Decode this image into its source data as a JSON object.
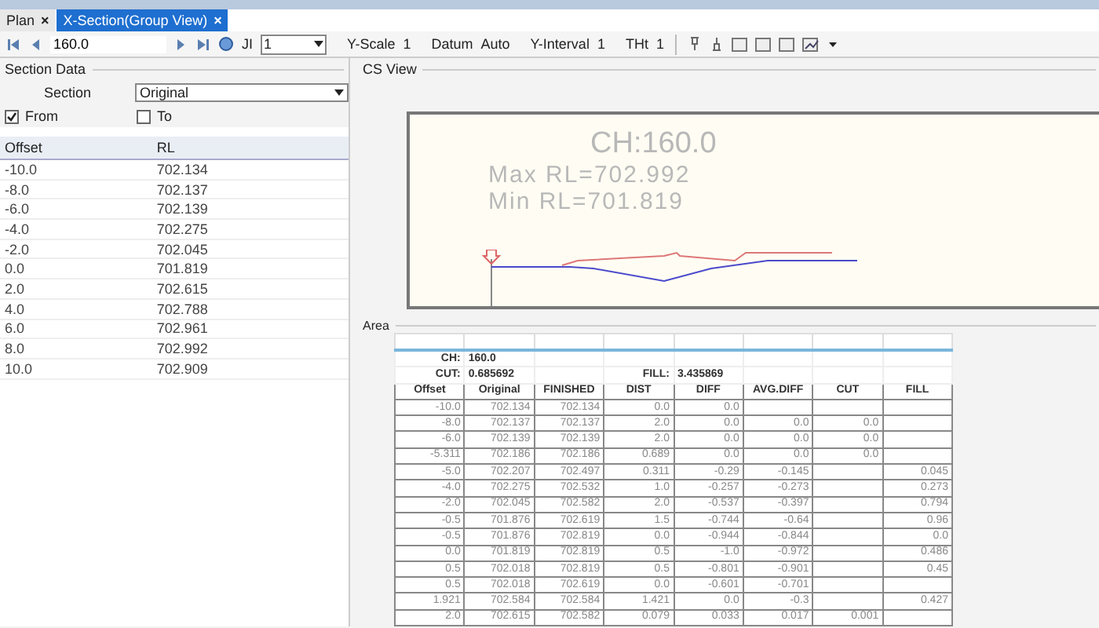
{
  "tabs": [
    {
      "label": "Plan",
      "selected": false,
      "close": "×"
    },
    {
      "label": "X-Section(Group View)",
      "selected": true,
      "close": "×"
    }
  ],
  "toolbar": {
    "chainage": "160.0",
    "ji_label": "JI",
    "ji_value": "1",
    "settings": [
      {
        "label": "Y-Scale",
        "value": "1"
      },
      {
        "label": "Datum",
        "value": "Auto"
      },
      {
        "label": "Y-Interval",
        "value": "1"
      },
      {
        "label": "THt",
        "value": "1"
      }
    ]
  },
  "section_data": {
    "title": "Section Data",
    "section_label": "Section",
    "section_value": "Original",
    "options": [
      {
        "label": "From",
        "checked": true
      },
      {
        "label": "To",
        "checked": false
      }
    ],
    "columns": [
      "Offset",
      "RL"
    ],
    "rows": [
      [
        "-10.0",
        "702.134"
      ],
      [
        "-8.0",
        "702.137"
      ],
      [
        "-6.0",
        "702.139"
      ],
      [
        "-4.0",
        "702.275"
      ],
      [
        "-2.0",
        "702.045"
      ],
      [
        "0.0",
        "701.819"
      ],
      [
        "2.0",
        "702.615"
      ],
      [
        "4.0",
        "702.788"
      ],
      [
        "6.0",
        "702.961"
      ],
      [
        "8.0",
        "702.992"
      ],
      [
        "10.0",
        "702.909"
      ]
    ]
  },
  "cs_view": {
    "title": "CS View",
    "chainage": "CH:160.0",
    "max": "Max  RL=702.992",
    "min": "Min  RL=701.819"
  },
  "area": {
    "title": "Area",
    "ch_label": "CH:",
    "ch_value": "160.0",
    "cut_label": "CUT:",
    "cut_value": "0.685692",
    "fill_label": "FILL:",
    "fill_value": "3.435869",
    "columns": [
      "Offset",
      "Original",
      "FINISHED",
      "DIST",
      "DIFF",
      "AVG.DIFF",
      "CUT",
      "FILL"
    ],
    "rows": [
      [
        "-10.0",
        "702.134",
        "702.134",
        "0.0",
        "0.0",
        null,
        null,
        null
      ],
      [
        "-8.0",
        "702.137",
        "702.137",
        "2.0",
        "0.0",
        "0.0",
        "0.0",
        null
      ],
      [
        "-6.0",
        "702.139",
        "702.139",
        "2.0",
        "0.0",
        "0.0",
        "0.0",
        null
      ],
      [
        "-5.311",
        "702.186",
        "702.186",
        "0.689",
        "0.0",
        "0.0",
        "0.0",
        null
      ],
      [
        "-5.0",
        "702.207",
        "702.497",
        "0.311",
        "-0.29",
        "-0.145",
        null,
        "0.045"
      ],
      [
        "-4.0",
        "702.275",
        "702.532",
        "1.0",
        "-0.257",
        "-0.273",
        null,
        "0.273"
      ],
      [
        "-2.0",
        "702.045",
        "702.582",
        "2.0",
        "-0.537",
        "-0.397",
        null,
        "0.794"
      ],
      [
        "-0.5",
        "701.876",
        "702.619",
        "1.5",
        "-0.744",
        "-0.64",
        null,
        "0.96"
      ],
      [
        "-0.5",
        "701.876",
        "702.819",
        "0.0",
        "-0.944",
        "-0.844",
        null,
        "0.0"
      ],
      [
        "0.0",
        "701.819",
        "702.819",
        "0.5",
        "-1.0",
        "-0.972",
        null,
        "0.486"
      ],
      [
        "0.5",
        "702.018",
        "702.819",
        "0.5",
        "-0.801",
        "-0.901",
        null,
        "0.45"
      ],
      [
        "0.5",
        "702.018",
        "702.619",
        "0.0",
        "-0.601",
        "-0.701",
        null,
        null
      ],
      [
        "1.921",
        "702.584",
        "702.584",
        "1.421",
        "0.0",
        "-0.3",
        null,
        "0.427"
      ],
      [
        "2.0",
        "702.615",
        "702.582",
        "0.079",
        "0.033",
        "0.017",
        "0.001",
        null
      ]
    ]
  }
}
